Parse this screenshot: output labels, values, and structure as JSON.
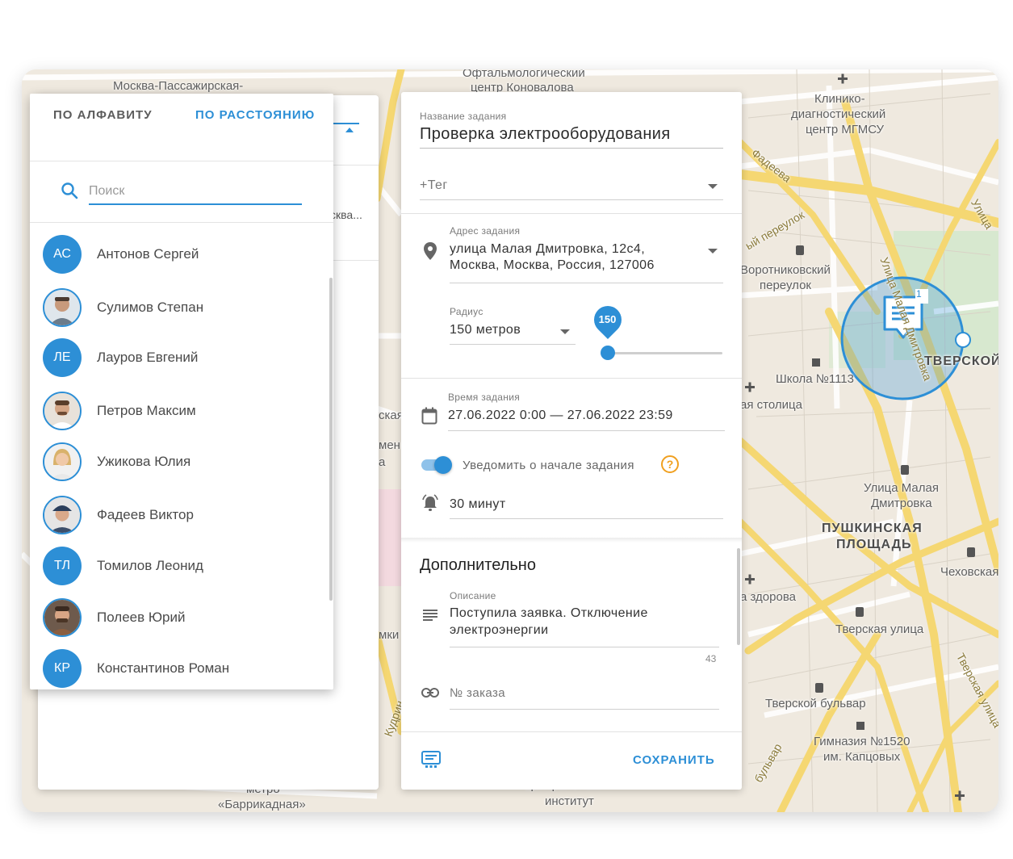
{
  "map": {
    "labels": {
      "l1": "Москва-Пассажирская-",
      "l2": "Офтальмологический",
      "l3": "центр Коновалова",
      "l4": "Клинико-",
      "l5": "диагностический",
      "l6": "центр МГМСУ",
      "l7": "Фадеева",
      "l8": "ый переулок",
      "l9": "Воротниковский",
      "l10": "переулок",
      "l11": "Улица",
      "l12": "Улица Малая Дмитровка",
      "l13": "Школа №1113",
      "l14": "ая столица",
      "l15": "ТВЕРСКОЙ",
      "l16": "Улица Малая",
      "l17": "Дмитровка",
      "l18": "ПУШКИНСКАЯ",
      "l19": "ПЛОЩАДЬ",
      "l20": "Чеховская",
      "l21": "а здорова",
      "l22": "Тверская улица",
      "l23": "Тверская улица",
      "l24": "Тверской бульвар",
      "l25": "Гимназия №1520",
      "l26": "им. Капцовых",
      "l27": "бульвар",
      "l28": "Центральный",
      "l29": "институт",
      "l30": "метро",
      "l31": "«Баррикадная»",
      "l32": "ская",
      "l33": "мен",
      "l34": "а",
      "l35": "мки",
      "l36": "Кудрин"
    },
    "marker_badge": "1"
  },
  "list_panel": {
    "partial_text": "сква..."
  },
  "dropdown": {
    "tab_alpha": "ПО АЛФАВИТУ",
    "tab_distance": "ПО РАССТОЯНИЮ",
    "search_placeholder": "Поиск",
    "people": [
      {
        "initials": "АС",
        "name": "Антонов Сергей"
      },
      {
        "initials": "",
        "name": "Сулимов Степан"
      },
      {
        "initials": "ЛЕ",
        "name": "Лауров Евгений"
      },
      {
        "initials": "",
        "name": "Петров Максим"
      },
      {
        "initials": "",
        "name": "Ужикова Юлия"
      },
      {
        "initials": "",
        "name": "Фадеев Виктор"
      },
      {
        "initials": "ТЛ",
        "name": "Томилов Леонид"
      },
      {
        "initials": "",
        "name": "Полеев Юрий"
      },
      {
        "initials": "КР",
        "name": "Константинов Роман"
      }
    ]
  },
  "form": {
    "task_name_label": "Название задания",
    "task_name": "Проверка электрооборудования",
    "tag_placeholder": "+Тег",
    "address_label": "Адрес задания",
    "address_line1": "улица Малая Дмитровка, 12с4,",
    "address_line2": "Москва, Москва, Россия, 127006",
    "radius_label": "Радиус",
    "radius_value": "150 метров",
    "slider_value": "150",
    "slider_fraction": 0.05,
    "time_label": "Время задания",
    "time_value": "27.06.2022 0:00 — 27.06.2022 23:59",
    "notify_label": "Уведомить о начале задания",
    "notify_enabled": true,
    "remind_value": "30 минут",
    "additional_title": "Дополнительно",
    "description_label": "Описание",
    "description_line1": "Поступила заявка. Отключение",
    "description_line2": "электроэнергии",
    "char_count": "43",
    "order_placeholder": "№ заказа",
    "save_button": "СОХРАНИТЬ"
  },
  "colors": {
    "accent": "#2d8fd6",
    "help": "#f0a020",
    "map_bg": "#efe9df",
    "road": "#f5d772"
  }
}
